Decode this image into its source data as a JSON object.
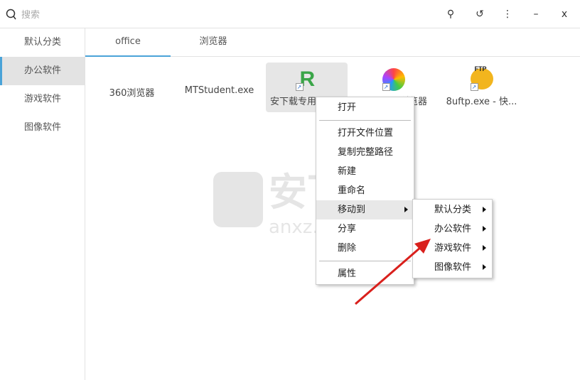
{
  "search": {
    "placeholder": "搜索",
    "icon": "search-icon"
  },
  "window_controls": [
    {
      "name": "pin-icon",
      "glyph": "⚲"
    },
    {
      "name": "history-icon",
      "glyph": "↺"
    },
    {
      "name": "more-icon",
      "glyph": "⋮"
    },
    {
      "name": "minimize-icon",
      "glyph": "–"
    },
    {
      "name": "close-icon",
      "glyph": "x"
    }
  ],
  "sidebar": {
    "items": [
      {
        "label": "默认分类"
      },
      {
        "label": "办公软件",
        "active": true
      },
      {
        "label": "游戏软件"
      },
      {
        "label": "图像软件"
      }
    ]
  },
  "tabs": [
    {
      "label": "office",
      "active": true
    },
    {
      "label": "浏览器"
    }
  ],
  "apps": [
    {
      "label": "360浏览器"
    },
    {
      "label": "MTStudent.exe"
    },
    {
      "label": "安下载专用"
    },
    {
      "label": "浏览器"
    },
    {
      "label": "8uftp.exe - 快..."
    }
  ],
  "context_menu": {
    "items": [
      "打开",
      "打开文件位置",
      "复制完整路径",
      "新建",
      "重命名",
      "移动到",
      "分享",
      "删除",
      "属性"
    ],
    "highlighted": "移动到"
  },
  "submenu": {
    "items": [
      "默认分类",
      "办公软件",
      "游戏软件",
      "图像软件"
    ]
  },
  "watermark": {
    "text": "安下载",
    "sub": "anxz.com"
  },
  "colors": {
    "accent": "#4aa3d8",
    "arrow": "#d9201c"
  }
}
